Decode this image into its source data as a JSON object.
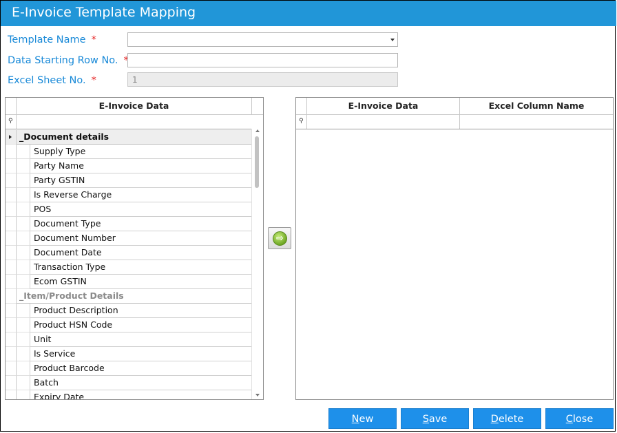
{
  "window": {
    "title": "E-Invoice Template Mapping"
  },
  "form": {
    "template_name": {
      "label": "Template Name",
      "required": "*",
      "value": ""
    },
    "data_starting_row": {
      "label": "Data Starting Row No.",
      "required": "*",
      "value": ""
    },
    "excel_sheet_no": {
      "label": "Excel Sheet No.",
      "required": "*",
      "value": "1"
    }
  },
  "left_grid": {
    "header": "E-Invoice Data",
    "groups": [
      {
        "label": "_Document details",
        "items": [
          "Supply Type",
          "Party Name",
          "Party GSTIN",
          "Is Reverse Charge",
          "POS",
          "Document Type",
          "Document Number",
          "Document Date",
          "Transaction Type",
          "Ecom GSTIN"
        ]
      },
      {
        "label": "_Item/Product Details",
        "items": [
          "Product Description",
          "Product HSN Code",
          "Unit",
          "Is Service",
          "Product Barcode",
          "Batch",
          "Expiry Date"
        ]
      }
    ]
  },
  "right_grid": {
    "headers": [
      "E-Invoice Data",
      "Excel Column Name"
    ],
    "rows": []
  },
  "move_button": {
    "icon": "right-arrow-icon"
  },
  "buttons": {
    "new": {
      "underlined": "N",
      "rest": "ew"
    },
    "save": {
      "underlined": "S",
      "rest": "ave"
    },
    "delete": {
      "underlined": "D",
      "rest": "elete"
    },
    "close": {
      "underlined": "C",
      "rest": "lose"
    }
  },
  "colors": {
    "accent": "#2196d8",
    "label": "#1a8ad8",
    "required": "#e52222",
    "button": "#1e90ea"
  }
}
